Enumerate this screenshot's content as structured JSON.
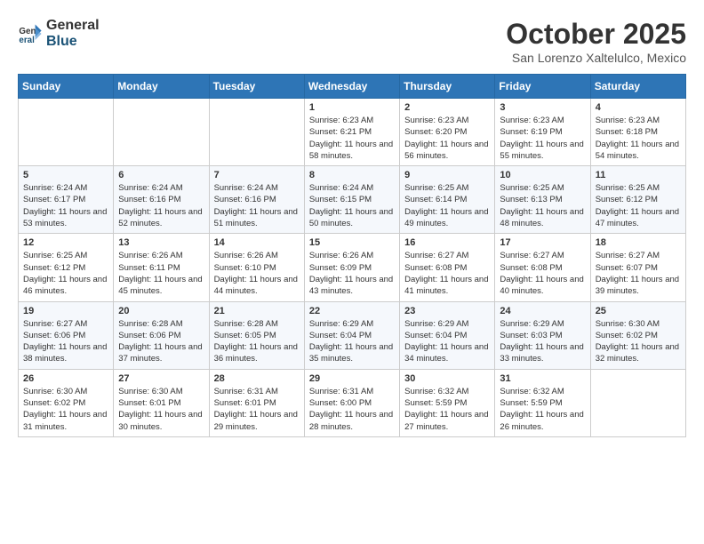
{
  "header": {
    "logo_general": "General",
    "logo_blue": "Blue",
    "month_title": "October 2025",
    "location": "San Lorenzo Xaltelulco, Mexico"
  },
  "weekdays": [
    "Sunday",
    "Monday",
    "Tuesday",
    "Wednesday",
    "Thursday",
    "Friday",
    "Saturday"
  ],
  "weeks": [
    [
      {
        "day": "",
        "info": ""
      },
      {
        "day": "",
        "info": ""
      },
      {
        "day": "",
        "info": ""
      },
      {
        "day": "1",
        "info": "Sunrise: 6:23 AM\nSunset: 6:21 PM\nDaylight: 11 hours and 58 minutes."
      },
      {
        "day": "2",
        "info": "Sunrise: 6:23 AM\nSunset: 6:20 PM\nDaylight: 11 hours and 56 minutes."
      },
      {
        "day": "3",
        "info": "Sunrise: 6:23 AM\nSunset: 6:19 PM\nDaylight: 11 hours and 55 minutes."
      },
      {
        "day": "4",
        "info": "Sunrise: 6:23 AM\nSunset: 6:18 PM\nDaylight: 11 hours and 54 minutes."
      }
    ],
    [
      {
        "day": "5",
        "info": "Sunrise: 6:24 AM\nSunset: 6:17 PM\nDaylight: 11 hours and 53 minutes."
      },
      {
        "day": "6",
        "info": "Sunrise: 6:24 AM\nSunset: 6:16 PM\nDaylight: 11 hours and 52 minutes."
      },
      {
        "day": "7",
        "info": "Sunrise: 6:24 AM\nSunset: 6:16 PM\nDaylight: 11 hours and 51 minutes."
      },
      {
        "day": "8",
        "info": "Sunrise: 6:24 AM\nSunset: 6:15 PM\nDaylight: 11 hours and 50 minutes."
      },
      {
        "day": "9",
        "info": "Sunrise: 6:25 AM\nSunset: 6:14 PM\nDaylight: 11 hours and 49 minutes."
      },
      {
        "day": "10",
        "info": "Sunrise: 6:25 AM\nSunset: 6:13 PM\nDaylight: 11 hours and 48 minutes."
      },
      {
        "day": "11",
        "info": "Sunrise: 6:25 AM\nSunset: 6:12 PM\nDaylight: 11 hours and 47 minutes."
      }
    ],
    [
      {
        "day": "12",
        "info": "Sunrise: 6:25 AM\nSunset: 6:12 PM\nDaylight: 11 hours and 46 minutes."
      },
      {
        "day": "13",
        "info": "Sunrise: 6:26 AM\nSunset: 6:11 PM\nDaylight: 11 hours and 45 minutes."
      },
      {
        "day": "14",
        "info": "Sunrise: 6:26 AM\nSunset: 6:10 PM\nDaylight: 11 hours and 44 minutes."
      },
      {
        "day": "15",
        "info": "Sunrise: 6:26 AM\nSunset: 6:09 PM\nDaylight: 11 hours and 43 minutes."
      },
      {
        "day": "16",
        "info": "Sunrise: 6:27 AM\nSunset: 6:08 PM\nDaylight: 11 hours and 41 minutes."
      },
      {
        "day": "17",
        "info": "Sunrise: 6:27 AM\nSunset: 6:08 PM\nDaylight: 11 hours and 40 minutes."
      },
      {
        "day": "18",
        "info": "Sunrise: 6:27 AM\nSunset: 6:07 PM\nDaylight: 11 hours and 39 minutes."
      }
    ],
    [
      {
        "day": "19",
        "info": "Sunrise: 6:27 AM\nSunset: 6:06 PM\nDaylight: 11 hours and 38 minutes."
      },
      {
        "day": "20",
        "info": "Sunrise: 6:28 AM\nSunset: 6:06 PM\nDaylight: 11 hours and 37 minutes."
      },
      {
        "day": "21",
        "info": "Sunrise: 6:28 AM\nSunset: 6:05 PM\nDaylight: 11 hours and 36 minutes."
      },
      {
        "day": "22",
        "info": "Sunrise: 6:29 AM\nSunset: 6:04 PM\nDaylight: 11 hours and 35 minutes."
      },
      {
        "day": "23",
        "info": "Sunrise: 6:29 AM\nSunset: 6:04 PM\nDaylight: 11 hours and 34 minutes."
      },
      {
        "day": "24",
        "info": "Sunrise: 6:29 AM\nSunset: 6:03 PM\nDaylight: 11 hours and 33 minutes."
      },
      {
        "day": "25",
        "info": "Sunrise: 6:30 AM\nSunset: 6:02 PM\nDaylight: 11 hours and 32 minutes."
      }
    ],
    [
      {
        "day": "26",
        "info": "Sunrise: 6:30 AM\nSunset: 6:02 PM\nDaylight: 11 hours and 31 minutes."
      },
      {
        "day": "27",
        "info": "Sunrise: 6:30 AM\nSunset: 6:01 PM\nDaylight: 11 hours and 30 minutes."
      },
      {
        "day": "28",
        "info": "Sunrise: 6:31 AM\nSunset: 6:01 PM\nDaylight: 11 hours and 29 minutes."
      },
      {
        "day": "29",
        "info": "Sunrise: 6:31 AM\nSunset: 6:00 PM\nDaylight: 11 hours and 28 minutes."
      },
      {
        "day": "30",
        "info": "Sunrise: 6:32 AM\nSunset: 5:59 PM\nDaylight: 11 hours and 27 minutes."
      },
      {
        "day": "31",
        "info": "Sunrise: 6:32 AM\nSunset: 5:59 PM\nDaylight: 11 hours and 26 minutes."
      },
      {
        "day": "",
        "info": ""
      }
    ]
  ]
}
